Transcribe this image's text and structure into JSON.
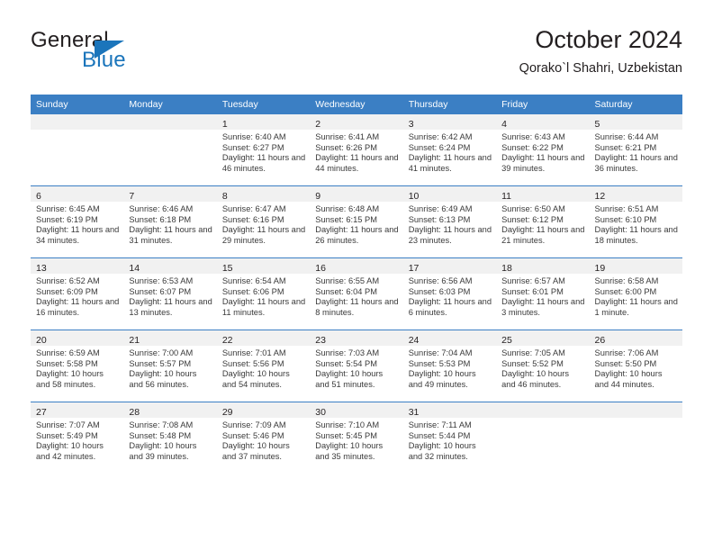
{
  "brand": {
    "word_one": "General",
    "word_two": "Blue",
    "accent_color": "#1b75bb"
  },
  "header": {
    "title": "October 2024",
    "subtitle": "Qorako`l Shahri, Uzbekistan"
  },
  "theme": {
    "header_bg": "#3b7fc4",
    "daynum_band": "#f1f1f1",
    "text": "#231f20"
  },
  "weekday_headers": [
    "Sunday",
    "Monday",
    "Tuesday",
    "Wednesday",
    "Thursday",
    "Friday",
    "Saturday"
  ],
  "weeks": [
    [
      {
        "day": "",
        "empty": true,
        "sunrise": "",
        "sunset": "",
        "daylight": ""
      },
      {
        "day": "",
        "empty": true,
        "sunrise": "",
        "sunset": "",
        "daylight": ""
      },
      {
        "day": "1",
        "empty": false,
        "sunrise": "Sunrise: 6:40 AM",
        "sunset": "Sunset: 6:27 PM",
        "daylight": "Daylight: 11 hours and 46 minutes."
      },
      {
        "day": "2",
        "empty": false,
        "sunrise": "Sunrise: 6:41 AM",
        "sunset": "Sunset: 6:26 PM",
        "daylight": "Daylight: 11 hours and 44 minutes."
      },
      {
        "day": "3",
        "empty": false,
        "sunrise": "Sunrise: 6:42 AM",
        "sunset": "Sunset: 6:24 PM",
        "daylight": "Daylight: 11 hours and 41 minutes."
      },
      {
        "day": "4",
        "empty": false,
        "sunrise": "Sunrise: 6:43 AM",
        "sunset": "Sunset: 6:22 PM",
        "daylight": "Daylight: 11 hours and 39 minutes."
      },
      {
        "day": "5",
        "empty": false,
        "sunrise": "Sunrise: 6:44 AM",
        "sunset": "Sunset: 6:21 PM",
        "daylight": "Daylight: 11 hours and 36 minutes."
      }
    ],
    [
      {
        "day": "6",
        "empty": false,
        "sunrise": "Sunrise: 6:45 AM",
        "sunset": "Sunset: 6:19 PM",
        "daylight": "Daylight: 11 hours and 34 minutes."
      },
      {
        "day": "7",
        "empty": false,
        "sunrise": "Sunrise: 6:46 AM",
        "sunset": "Sunset: 6:18 PM",
        "daylight": "Daylight: 11 hours and 31 minutes."
      },
      {
        "day": "8",
        "empty": false,
        "sunrise": "Sunrise: 6:47 AM",
        "sunset": "Sunset: 6:16 PM",
        "daylight": "Daylight: 11 hours and 29 minutes."
      },
      {
        "day": "9",
        "empty": false,
        "sunrise": "Sunrise: 6:48 AM",
        "sunset": "Sunset: 6:15 PM",
        "daylight": "Daylight: 11 hours and 26 minutes."
      },
      {
        "day": "10",
        "empty": false,
        "sunrise": "Sunrise: 6:49 AM",
        "sunset": "Sunset: 6:13 PM",
        "daylight": "Daylight: 11 hours and 23 minutes."
      },
      {
        "day": "11",
        "empty": false,
        "sunrise": "Sunrise: 6:50 AM",
        "sunset": "Sunset: 6:12 PM",
        "daylight": "Daylight: 11 hours and 21 minutes."
      },
      {
        "day": "12",
        "empty": false,
        "sunrise": "Sunrise: 6:51 AM",
        "sunset": "Sunset: 6:10 PM",
        "daylight": "Daylight: 11 hours and 18 minutes."
      }
    ],
    [
      {
        "day": "13",
        "empty": false,
        "sunrise": "Sunrise: 6:52 AM",
        "sunset": "Sunset: 6:09 PM",
        "daylight": "Daylight: 11 hours and 16 minutes."
      },
      {
        "day": "14",
        "empty": false,
        "sunrise": "Sunrise: 6:53 AM",
        "sunset": "Sunset: 6:07 PM",
        "daylight": "Daylight: 11 hours and 13 minutes."
      },
      {
        "day": "15",
        "empty": false,
        "sunrise": "Sunrise: 6:54 AM",
        "sunset": "Sunset: 6:06 PM",
        "daylight": "Daylight: 11 hours and 11 minutes."
      },
      {
        "day": "16",
        "empty": false,
        "sunrise": "Sunrise: 6:55 AM",
        "sunset": "Sunset: 6:04 PM",
        "daylight": "Daylight: 11 hours and 8 minutes."
      },
      {
        "day": "17",
        "empty": false,
        "sunrise": "Sunrise: 6:56 AM",
        "sunset": "Sunset: 6:03 PM",
        "daylight": "Daylight: 11 hours and 6 minutes."
      },
      {
        "day": "18",
        "empty": false,
        "sunrise": "Sunrise: 6:57 AM",
        "sunset": "Sunset: 6:01 PM",
        "daylight": "Daylight: 11 hours and 3 minutes."
      },
      {
        "day": "19",
        "empty": false,
        "sunrise": "Sunrise: 6:58 AM",
        "sunset": "Sunset: 6:00 PM",
        "daylight": "Daylight: 11 hours and 1 minute."
      }
    ],
    [
      {
        "day": "20",
        "empty": false,
        "sunrise": "Sunrise: 6:59 AM",
        "sunset": "Sunset: 5:58 PM",
        "daylight": "Daylight: 10 hours and 58 minutes."
      },
      {
        "day": "21",
        "empty": false,
        "sunrise": "Sunrise: 7:00 AM",
        "sunset": "Sunset: 5:57 PM",
        "daylight": "Daylight: 10 hours and 56 minutes."
      },
      {
        "day": "22",
        "empty": false,
        "sunrise": "Sunrise: 7:01 AM",
        "sunset": "Sunset: 5:56 PM",
        "daylight": "Daylight: 10 hours and 54 minutes."
      },
      {
        "day": "23",
        "empty": false,
        "sunrise": "Sunrise: 7:03 AM",
        "sunset": "Sunset: 5:54 PM",
        "daylight": "Daylight: 10 hours and 51 minutes."
      },
      {
        "day": "24",
        "empty": false,
        "sunrise": "Sunrise: 7:04 AM",
        "sunset": "Sunset: 5:53 PM",
        "daylight": "Daylight: 10 hours and 49 minutes."
      },
      {
        "day": "25",
        "empty": false,
        "sunrise": "Sunrise: 7:05 AM",
        "sunset": "Sunset: 5:52 PM",
        "daylight": "Daylight: 10 hours and 46 minutes."
      },
      {
        "day": "26",
        "empty": false,
        "sunrise": "Sunrise: 7:06 AM",
        "sunset": "Sunset: 5:50 PM",
        "daylight": "Daylight: 10 hours and 44 minutes."
      }
    ],
    [
      {
        "day": "27",
        "empty": false,
        "sunrise": "Sunrise: 7:07 AM",
        "sunset": "Sunset: 5:49 PM",
        "daylight": "Daylight: 10 hours and 42 minutes."
      },
      {
        "day": "28",
        "empty": false,
        "sunrise": "Sunrise: 7:08 AM",
        "sunset": "Sunset: 5:48 PM",
        "daylight": "Daylight: 10 hours and 39 minutes."
      },
      {
        "day": "29",
        "empty": false,
        "sunrise": "Sunrise: 7:09 AM",
        "sunset": "Sunset: 5:46 PM",
        "daylight": "Daylight: 10 hours and 37 minutes."
      },
      {
        "day": "30",
        "empty": false,
        "sunrise": "Sunrise: 7:10 AM",
        "sunset": "Sunset: 5:45 PM",
        "daylight": "Daylight: 10 hours and 35 minutes."
      },
      {
        "day": "31",
        "empty": false,
        "sunrise": "Sunrise: 7:11 AM",
        "sunset": "Sunset: 5:44 PM",
        "daylight": "Daylight: 10 hours and 32 minutes."
      },
      {
        "day": "",
        "empty": true,
        "sunrise": "",
        "sunset": "",
        "daylight": ""
      },
      {
        "day": "",
        "empty": true,
        "sunrise": "",
        "sunset": "",
        "daylight": ""
      }
    ]
  ]
}
